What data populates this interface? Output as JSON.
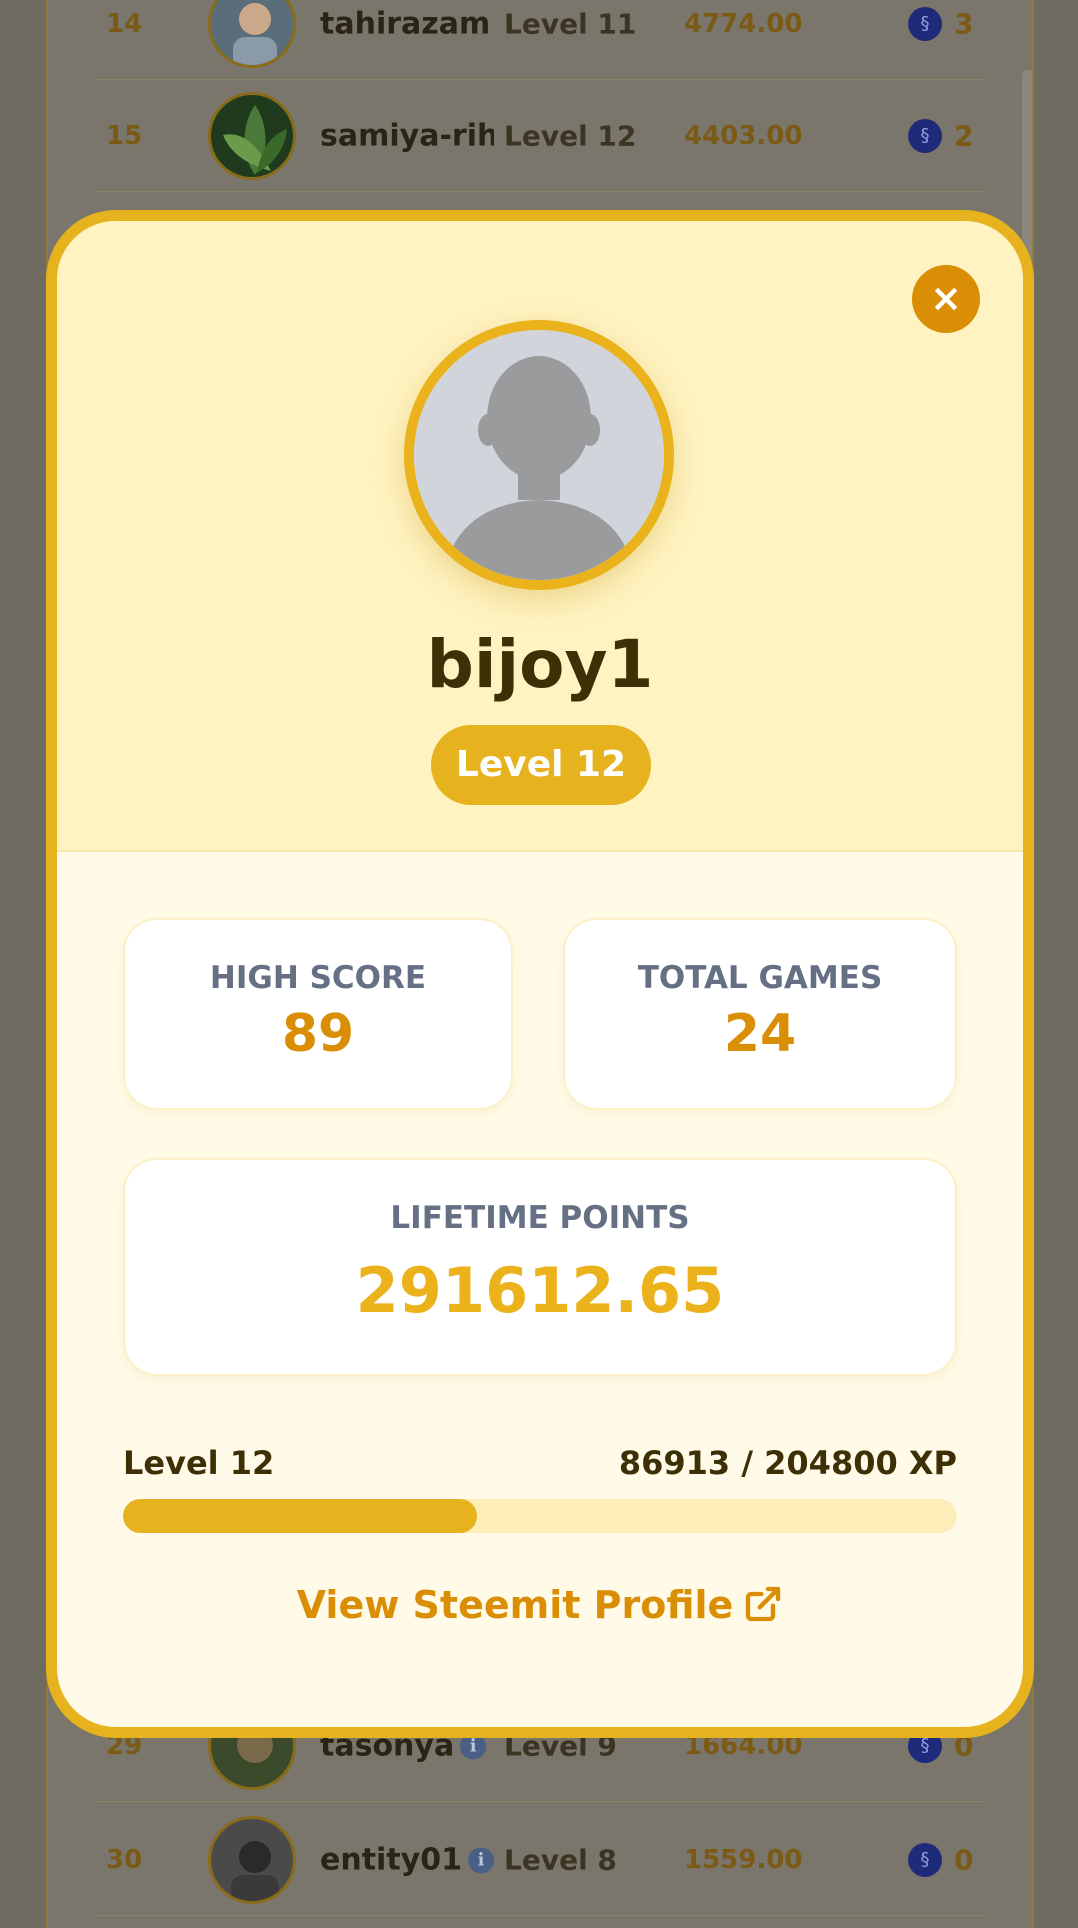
{
  "leaderboard": {
    "rows": [
      {
        "rank": "14",
        "name": "tahirazam",
        "level": "Level 11",
        "points": "4774.00",
        "count": "3",
        "info": false
      },
      {
        "rank": "15",
        "name": "samiya-rih",
        "level": "Level 12",
        "points": "4403.00",
        "count": "2",
        "info": false
      },
      {
        "rank": "29",
        "name": "tasonya",
        "level": "Level 9",
        "points": "1664.00",
        "count": "0",
        "info": true
      },
      {
        "rank": "30",
        "name": "entity01",
        "level": "Level 8",
        "points": "1559.00",
        "count": "0",
        "info": true
      }
    ]
  },
  "profile": {
    "username": "bijoy1",
    "level_badge": "Level 12",
    "close_label": "×",
    "stats": {
      "high_score_label": "HIGH SCORE",
      "high_score_value": "89",
      "total_games_label": "TOTAL GAMES",
      "total_games_value": "24",
      "lifetime_points_label": "LIFETIME POINTS",
      "lifetime_points_value": "291612.65"
    },
    "xp": {
      "level_label": "Level 12",
      "progress_text": "86913 / 204800 XP",
      "current": 86913,
      "total": 204800
    },
    "link_label": "View Steemit Profile"
  },
  "colors": {
    "accent": "#e6b21d",
    "accent_dark": "#d98e06",
    "header_bg": "#fff3c1",
    "body_bg": "#fffbe8",
    "text_dark": "#3d2f06",
    "label_gray": "#667084"
  },
  "icons": [
    "close-icon",
    "external-link-icon",
    "steem-coin-icon",
    "info-icon",
    "avatar-placeholder-icon"
  ]
}
